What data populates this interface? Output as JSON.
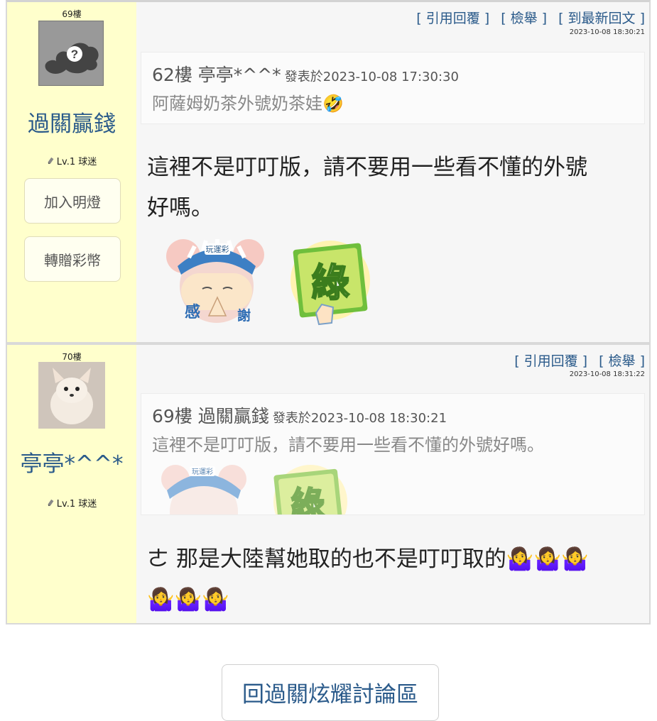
{
  "posts": [
    {
      "floor": "69樓",
      "username": "過關贏錢",
      "level": "Lv.1 球迷",
      "buttons": {
        "add_light": "加入明燈",
        "gift": "轉贈彩幣"
      },
      "links": {
        "quote_reply": "[ 引用回覆 ]",
        "report": "[ 檢舉 ]",
        "latest": "[ 到最新回文 ]"
      },
      "timestamp": "2023-10-08 18:30:21",
      "quote": {
        "floor_user": "62樓 亭亭*^^*",
        "date": "發表於2023-10-08 17:30:30",
        "text": "阿薩姆奶茶外號奶茶娃🤣"
      },
      "content_line1": "這裡不是叮叮版，請不要用一些看不懂的外號",
      "content_line2": "好嗎。",
      "stickers": {
        "thanks": "感",
        "thanks2": "謝",
        "cap": "玩運彩",
        "green": "綠"
      }
    },
    {
      "floor": "70樓",
      "username": "亭亭*^^*",
      "level": "Lv.1 球迷",
      "links": {
        "quote_reply": "[ 引用回覆 ]",
        "report": "[ 檢舉 ]"
      },
      "timestamp": "2023-10-08 18:31:22",
      "quote": {
        "floor_user": "69樓 過關贏錢",
        "date": "發表於2023-10-08 18:30:21",
        "text": "這裡不是叮叮版，請不要用一些看不懂的外號好嗎。"
      },
      "content_line1": "ㄜ 那是大陸幫她取的也不是叮叮取的🤷‍♀️🤷‍♀️🤷‍♀️",
      "content_line2": "🤷‍♀️🤷‍♀️🤷‍♀️",
      "stickers": {
        "cap": "玩運彩",
        "green": "綠"
      }
    }
  ],
  "back_button": "回過關炫耀討論區",
  "colors": {
    "accent": "#2a5a8a",
    "sidebar": "#ffffcc"
  }
}
